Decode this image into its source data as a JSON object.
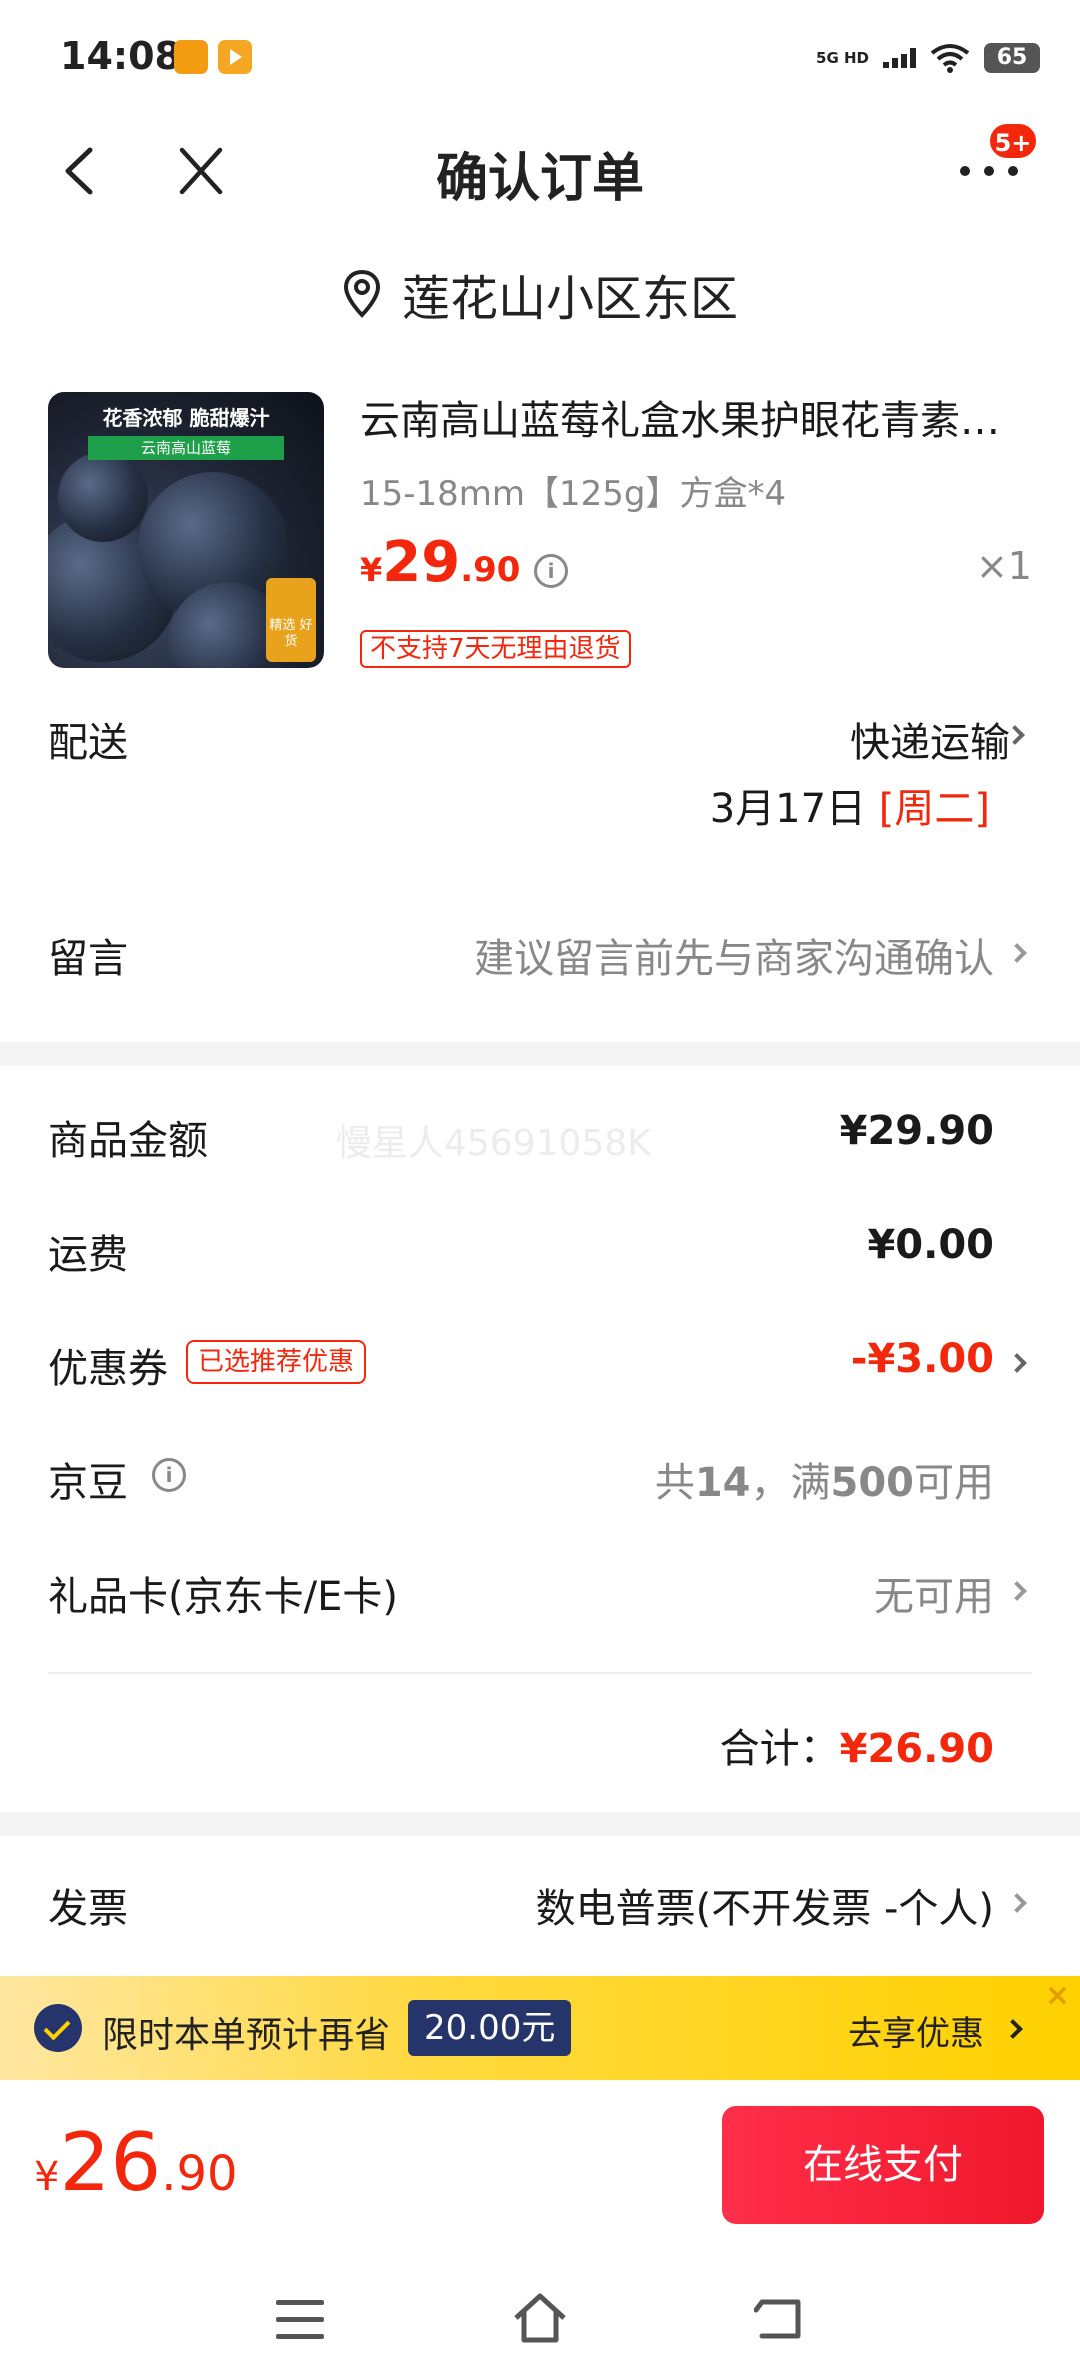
{
  "status_bar": {
    "time": "14:08",
    "network": "5G HD",
    "battery": "65",
    "icons": [
      "app-notification-icon",
      "video-app-icon",
      "signal-icon",
      "wifi-icon",
      "battery-icon"
    ]
  },
  "header": {
    "title": "确认订单",
    "more_badge": "5+"
  },
  "address": {
    "text": "莲花山小区东区"
  },
  "product": {
    "image_caption_top": "花香浓郁 脆甜爆汁",
    "image_caption_bottom": "云南高山蓝莓",
    "image_badge": "精选 好货",
    "title": "云南高山蓝莓礼盒水果护眼花青素…",
    "spec": "15-18mm【125g】方盒*4",
    "price_symbol": "¥",
    "price_int": "29",
    "price_dec": ".90",
    "quantity": "×1",
    "return_tag": "不支持7天无理由退货"
  },
  "delivery": {
    "label": "配送",
    "method": "快递运输",
    "date": "3月17日",
    "weekday": "[周二]"
  },
  "message": {
    "label": "留言",
    "placeholder": "建议留言前先与商家沟通确认"
  },
  "summary": {
    "watermark": "慢星人45691058K",
    "goods_label": "商品金额",
    "goods_value": "¥29.90",
    "shipping_label": "运费",
    "shipping_value": "¥0.00",
    "coupon_label": "优惠券",
    "coupon_tag": "已选推荐优惠",
    "coupon_value": "-¥3.00",
    "beans_label": "京豆",
    "beans_value_prefix": "共",
    "beans_count": "14",
    "beans_value_mid": "，满",
    "beans_threshold": "500",
    "beans_value_suffix": "可用",
    "giftcard_label": "礼品卡(京东卡/E卡)",
    "giftcard_value": "无可用",
    "total_label": "合计：",
    "total_value": "¥26.90"
  },
  "invoice": {
    "label": "发票",
    "value": "数电普票(不开发票 -个人)"
  },
  "promo": {
    "text": "限时本单预计再省",
    "amount": "20.00元",
    "action": "去享优惠",
    "close": "×"
  },
  "bottom_bar": {
    "price_symbol": "¥",
    "price_int": "26",
    "price_dec": ".90",
    "pay_label": "在线支付"
  },
  "colors": {
    "accent_red": "#f2270c",
    "promo_yellow": "#ffd100",
    "promo_navy": "#25356b"
  }
}
